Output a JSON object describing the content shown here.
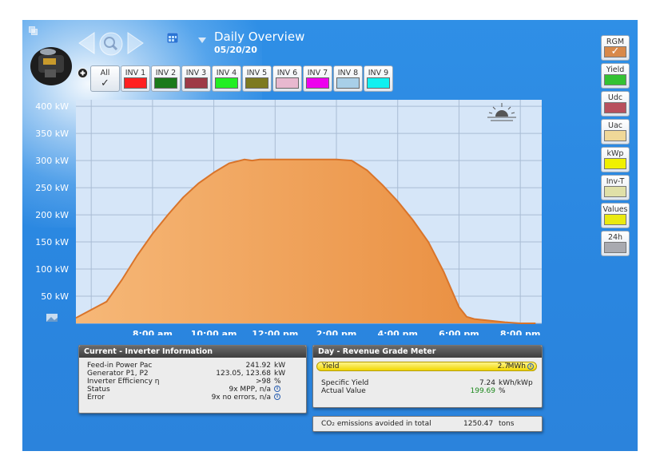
{
  "header": {
    "title": "Daily Overview",
    "date": "05/20/20"
  },
  "tabs": [
    {
      "label": "All",
      "color": "",
      "checked": true
    },
    {
      "label": "INV 1",
      "color": "#ff2020"
    },
    {
      "label": "INV 2",
      "color": "#1a7a1a"
    },
    {
      "label": "INV 3",
      "color": "#9e3a46"
    },
    {
      "label": "INV 4",
      "color": "#22ee22"
    },
    {
      "label": "INV 5",
      "color": "#7d7a20"
    },
    {
      "label": "INV 6",
      "color": "#e8b8cf"
    },
    {
      "label": "INV 7",
      "color": "#ee00ee"
    },
    {
      "label": "INV 8",
      "color": "#a8cfe8"
    },
    {
      "label": "INV 9",
      "color": "#10f0f0"
    }
  ],
  "right_buttons": [
    {
      "label": "RGM",
      "color": "#d8894a",
      "checked": true
    },
    {
      "label": "Yield",
      "color": "#33c233"
    },
    {
      "label": "Udc",
      "color": "#b8505e"
    },
    {
      "label": "Uac",
      "color": "#f0d898"
    },
    {
      "label": "kWp",
      "color": "#f0f000"
    },
    {
      "label": "Inv-T",
      "color": "#e0e0a8"
    },
    {
      "label": "Values",
      "color": "#eaea10"
    },
    {
      "label": "24h",
      "color": "#a9aab0"
    }
  ],
  "chart_data": {
    "type": "area",
    "ylabels": [
      "400 kW",
      "350 kW",
      "300 kW",
      "250 kW",
      "200 kW",
      "150 kW",
      "100 kW",
      "50 kW"
    ],
    "xlabels": [
      "8:00 am",
      "10:00 am",
      "12:00 pm",
      "2:00 pm",
      "4:00 pm",
      "6:00 pm",
      "8:00 pm"
    ],
    "ylim": [
      0,
      400
    ],
    "x": [
      5.5,
      6.0,
      6.5,
      7.0,
      7.5,
      8.0,
      8.5,
      9.0,
      9.5,
      10.0,
      10.5,
      11.0,
      11.25,
      11.5,
      12.0,
      12.5,
      13.0,
      13.5,
      14.0,
      14.5,
      15.0,
      15.5,
      16.0,
      16.5,
      17.0,
      17.5,
      18.0,
      18.25,
      18.5,
      19.0,
      19.5,
      20.0,
      20.5
    ],
    "values": [
      10,
      25,
      40,
      80,
      125,
      165,
      200,
      232,
      258,
      278,
      295,
      302,
      300,
      302,
      302,
      302,
      302,
      302,
      302,
      300,
      282,
      255,
      225,
      190,
      150,
      95,
      30,
      12,
      8,
      5,
      2,
      0,
      0
    ],
    "color": "#f0a860",
    "line_color": "#d9742a",
    "grid": true,
    "legend": "none"
  },
  "current_panel": {
    "title": "Current - Inverter Information",
    "rows": [
      {
        "label": "Feed-in Power Pac",
        "value": "241.92",
        "unit": "kW",
        "info": false
      },
      {
        "label": "Generator P1, P2",
        "value": "123.05, 123.68",
        "unit": "kW",
        "info": false
      },
      {
        "label": "Inverter Efficiency η",
        "value": ">98",
        "unit": "%",
        "info": false
      },
      {
        "label": "Status",
        "value": "9x MPP, n/a",
        "unit": "",
        "info": true
      },
      {
        "label": "Error",
        "value": "9x no errors, n/a",
        "unit": "",
        "info": true
      }
    ]
  },
  "day_panel": {
    "title": "Day - Revenue Grade Meter",
    "yield_label": "Yield",
    "yield_value": "2.7",
    "yield_unit": "MWh",
    "specific_label": "Specific Yield",
    "specific_value": "7.24",
    "specific_unit": "kWh/kWp",
    "actual_label": "Actual Value",
    "actual_value": "199.69",
    "actual_unit": "%"
  },
  "co2": {
    "label": "CO₂ emissions avoided in total",
    "value": "1250.47",
    "unit": "tons"
  },
  "icons": [
    "window-icon",
    "device-icon",
    "arrow-left-icon",
    "search-icon",
    "arrow-right-icon",
    "calendar-icon",
    "dropdown-triangle-icon",
    "plus-icon",
    "checkmark-icon",
    "sun-icon",
    "image-icon",
    "info-icon"
  ]
}
